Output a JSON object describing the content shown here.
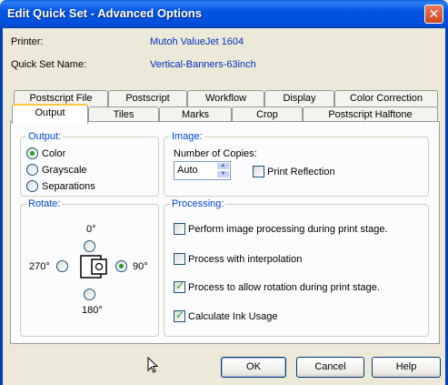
{
  "window": {
    "title": "Edit Quick Set - Advanced Options",
    "close_icon": "close-icon"
  },
  "info": {
    "printer_label": "Printer:",
    "printer_value": "Mutoh ValueJet 1604",
    "quickset_label": "Quick Set Name:",
    "quickset_value": "Vertical-Banners-63inch"
  },
  "tabs_back": [
    "Postscript File",
    "Postscript",
    "Workflow",
    "Display",
    "Color Correction"
  ],
  "tabs_front": [
    "Output",
    "Tiles",
    "Marks",
    "Crop",
    "Postscript Halftone"
  ],
  "active_tab": "Output",
  "output": {
    "title": "Output:",
    "options": [
      "Color",
      "Grayscale",
      "Separations"
    ],
    "selected": "Color"
  },
  "rotate": {
    "title": "Rotate:",
    "deg0": "0°",
    "deg90": "90°",
    "deg180": "180°",
    "deg270": "270°",
    "selected": "90°"
  },
  "image": {
    "title": "Image:",
    "copies_label": "Number of Copies:",
    "copies_value": "Auto",
    "print_reflection": "Print Reflection",
    "print_reflection_checked": false
  },
  "processing": {
    "title": "Processing:",
    "items": [
      {
        "label": "Perform image processing during print stage.",
        "checked": false
      },
      {
        "label": "Process with interpolation",
        "checked": false
      },
      {
        "label": "Process to allow rotation during print stage.",
        "checked": true
      },
      {
        "label": "Calculate Ink Usage",
        "checked": true
      }
    ]
  },
  "buttons": {
    "ok": "OK",
    "cancel": "Cancel",
    "help": "Help"
  }
}
